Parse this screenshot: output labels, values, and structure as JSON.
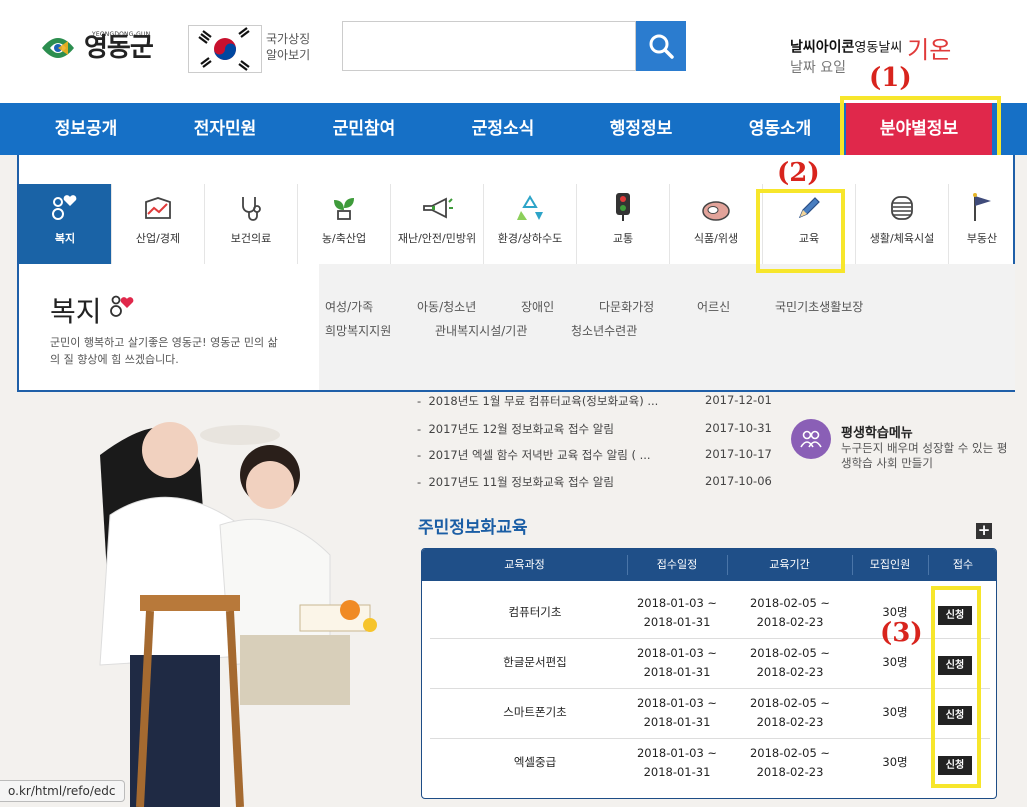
{
  "header": {
    "logo_name": "영동군",
    "logo_sub": "YEONGDONG-GUN",
    "national_symbol_line1": "국가상징",
    "national_symbol_line2": "알아보기",
    "search_placeholder": "",
    "weather_label": "날씨아이콘",
    "weather_city": "영동날씨",
    "weather_temp": "기온",
    "weather_date": "날짜 요일"
  },
  "annotations": [
    "(1)",
    "(2)",
    "(3)"
  ],
  "nav": {
    "items": [
      "정보공개",
      "전자민원",
      "군민참여",
      "군정소식",
      "행정정보",
      "영동소개",
      "분야별정보"
    ],
    "active_index": 6
  },
  "categories": [
    {
      "label": "복지",
      "icon": "welfare-icon",
      "active": true
    },
    {
      "label": "산업/경제",
      "icon": "industry-chart-icon"
    },
    {
      "label": "보건의료",
      "icon": "stethoscope-icon"
    },
    {
      "label": "농/축산업",
      "icon": "sprout-icon"
    },
    {
      "label": "재난/안전/민방위",
      "icon": "megaphone-icon"
    },
    {
      "label": "환경/상하수도",
      "icon": "recycle-icon"
    },
    {
      "label": "교통",
      "icon": "traffic-light-icon"
    },
    {
      "label": "식품/위생",
      "icon": "meat-icon"
    },
    {
      "label": "교육",
      "icon": "pencil-icon"
    },
    {
      "label": "생활/체육시설",
      "icon": "facility-icon"
    },
    {
      "label": "부동산",
      "icon": "flag-icon"
    }
  ],
  "submenu": {
    "title": "복지",
    "description": "군민이 행복하고 살기좋은 영동군! 영동군 민의 삶의 질 향상에 힘 쓰겠습니다.",
    "links_row1": [
      "여성/가족",
      "아동/청소년",
      "장애인",
      "다문화가정",
      "어르신",
      "국민기초생활보장"
    ],
    "links_row2": [
      "희망복지지원",
      "관내복지시설/기관",
      "청소년수련관"
    ]
  },
  "news": [
    {
      "title": "2018년도 1월 무료 컴퓨터교육(정보화교육) ...",
      "date": "2017-12-01"
    },
    {
      "title": "2017년도 12월 정보화교육 접수 알림",
      "date": "2017-10-31"
    },
    {
      "title": "2017년 엑셀 함수 저녁반 교육 접수 알림 ( ...",
      "date": "2017-10-17"
    },
    {
      "title": "2017년도 11월 정보화교육 접수 알림",
      "date": "2017-10-06"
    }
  ],
  "lifelong": {
    "title": "평생학습메뉴",
    "description": "누구든지 배우며 성장할 수 있는 평생학습 사회 만들기"
  },
  "education": {
    "section_title": "주민정보화교육",
    "plus_label": "+",
    "headers": [
      "교육과정",
      "접수일정",
      "교육기간",
      "모집인원",
      "접수"
    ],
    "rows": [
      {
        "course": "컴퓨터기초",
        "reg_start": "2018-01-03 ~",
        "reg_end": "2018-01-31",
        "period_start": "2018-02-05 ~",
        "period_end": "2018-02-23",
        "capacity": "30명",
        "apply": "신청"
      },
      {
        "course": "한글문서편집",
        "reg_start": "2018-01-03 ~",
        "reg_end": "2018-01-31",
        "period_start": "2018-02-05 ~",
        "period_end": "2018-02-23",
        "capacity": "30명",
        "apply": "신청"
      },
      {
        "course": "스마트폰기초",
        "reg_start": "2018-01-03 ~",
        "reg_end": "2018-01-31",
        "period_start": "2018-02-05 ~",
        "period_end": "2018-02-23",
        "capacity": "30명",
        "apply": "신청"
      },
      {
        "course": "엑셀중급",
        "reg_start": "2018-01-03 ~",
        "reg_end": "2018-01-31",
        "period_start": "2018-02-05 ~",
        "period_end": "2018-02-23",
        "capacity": "30명",
        "apply": "신청"
      }
    ]
  },
  "status_bar": "o.kr/html/refo/edc",
  "colors": {
    "nav_blue": "#1670c6",
    "nav_active": "#e0284b",
    "category_active": "#1a63a6",
    "highlight_yellow": "#f7e62b",
    "annotation_red": "#d8241d",
    "table_header": "#1f4f88"
  }
}
